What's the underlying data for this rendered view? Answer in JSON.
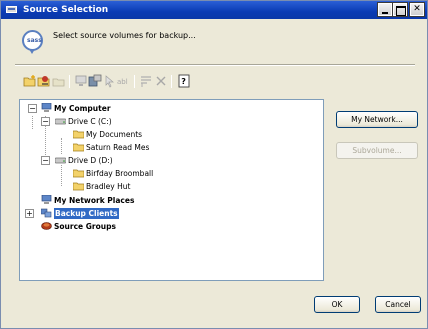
{
  "window": {
    "title": "Source Selection"
  },
  "header": {
    "icon": "speech-bubble-icon",
    "icon_text": "sass",
    "instruction": "Select source volumes for backup..."
  },
  "toolbar": {
    "icons": [
      "new-folder-icon",
      "open-icon",
      "remove-icon",
      "network-icon",
      "properties-icon",
      "pointer-icon",
      "rename-icon",
      "filter-icon",
      "delete-icon",
      "help-icon"
    ]
  },
  "tree": {
    "items": [
      {
        "label": "My Computer",
        "icon": "computer-icon",
        "bold": true,
        "expander": "−"
      },
      {
        "label": "Drive C (C:)",
        "icon": "drive-icon",
        "bold": false,
        "expander": "−"
      },
      {
        "label": "My Documents",
        "icon": "folder-icon",
        "bold": false
      },
      {
        "label": "Saturn Read Mes",
        "icon": "folder-icon",
        "bold": false
      },
      {
        "label": "Drive D (D:)",
        "icon": "drive-icon",
        "bold": false,
        "expander": "−"
      },
      {
        "label": "Birfday Broomball",
        "icon": "folder-icon",
        "bold": false
      },
      {
        "label": "Bradley Hut",
        "icon": "folder-icon",
        "bold": false
      },
      {
        "label": "My Network Places",
        "icon": "network-places-icon",
        "bold": true
      },
      {
        "label": "Backup Clients",
        "icon": "backup-clients-icon",
        "bold": true,
        "selected": true,
        "expander": "+"
      },
      {
        "label": "Source Groups",
        "icon": "source-groups-icon",
        "bold": true
      }
    ]
  },
  "buttons": {
    "network": "My Network...",
    "subvolume": "Subvolume...",
    "ok": "OK",
    "cancel": "Cancel"
  },
  "colors": {
    "titlebar": "#0a3bb4",
    "selection": "#316ac5",
    "folder": "#f3d26a",
    "dialog": "#ece9d8"
  }
}
